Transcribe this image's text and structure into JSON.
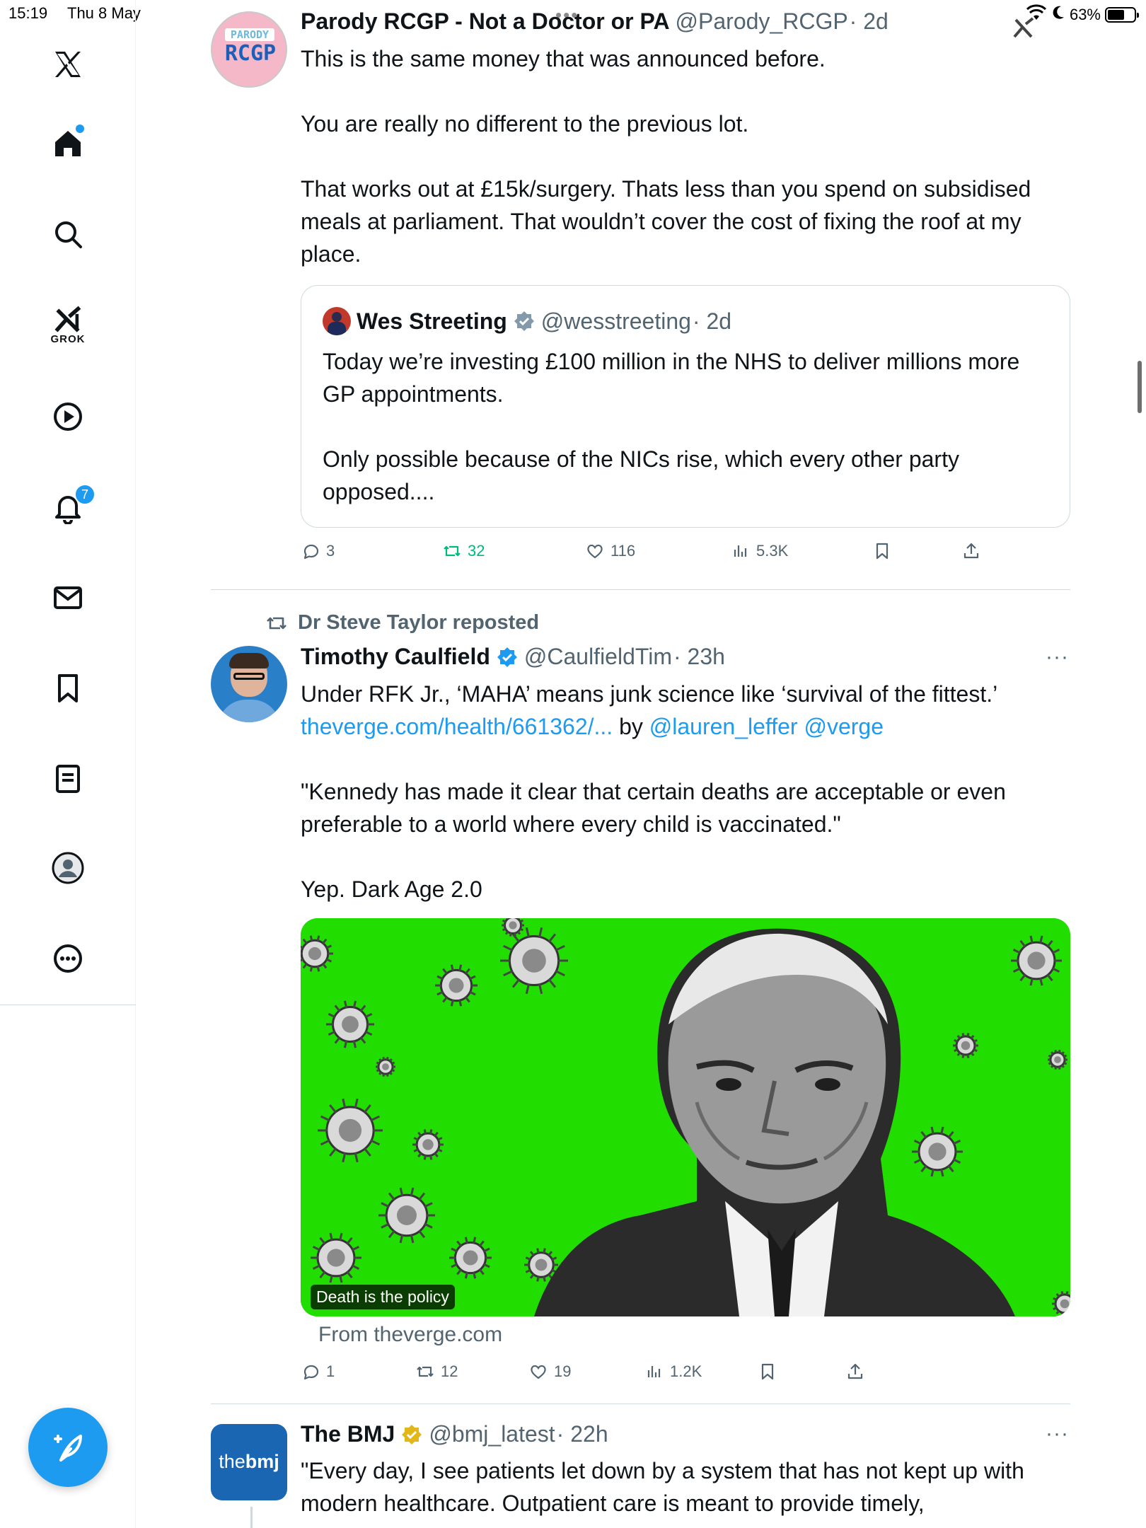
{
  "status_bar": {
    "time": "15:19",
    "date": "Thu 8 May",
    "battery": "63%",
    "battery_level": 0.63
  },
  "sidebar": {
    "notifications_badge": "7",
    "grok_label": "GROK"
  },
  "tweets": [
    {
      "name": "Parody RCGP - Not a Doctor or PA",
      "handle": "@Parody_RCGP",
      "time": "· 2d",
      "avatar_top": "PARODY",
      "avatar_main": "RCGP",
      "text": "This is the same money that was announced before.\n\nYou are really no different to the previous lot.\n\nThat works out at £15k/surgery. Thats less than you spend on subsidised meals at parliament. That wouldn’t cover the cost of fixing the roof at my place.",
      "quote": {
        "name": "Wes Streeting",
        "handle": "@wesstreeting",
        "time": "· 2d",
        "text": "Today we’re investing £100 million in the NHS to deliver millions more GP appointments.\n\nOnly possible because of the NICs rise, which every other party opposed...."
      },
      "replies": "3",
      "reposts": "32",
      "likes": "116",
      "views": "5.3K"
    },
    {
      "reposted_by": "Dr Steve Taylor reposted",
      "name": "Timothy Caulfield",
      "handle": "@CaulfieldTim",
      "time": "· 23h",
      "text_line1": "Under RFK Jr., ‘MAHA’ means junk science like ‘survival of the fittest.’",
      "link_url": "theverge.com/health/661362/...",
      "link_by": " by ",
      "mention1": "@lauren_leffer",
      "mention2": " @verge",
      "text_rest": "\"Kennedy has made it clear that certain deaths are acceptable or even preferable to a world where every child is vaccinated.\"\n\nYep. Dark Age 2.0",
      "media_caption": "Death is the policy",
      "from": "From theverge.com",
      "replies": "1",
      "reposts": "12",
      "likes": "19",
      "views": "1.2K"
    },
    {
      "name": "The BMJ",
      "handle": "@bmj_latest",
      "time": "· 22h",
      "avatar_the": "the",
      "avatar_bmj": "bmj",
      "text": "\"Every day, I see patients let down by a system that has not kept up with modern healthcare. Outpatient care is meant to provide timely,"
    }
  ],
  "colors": {
    "accent": "#1d9bf0",
    "repost_green": "#00ba7c",
    "media_green": "#22dd00",
    "bmj_blue": "#1a66b3",
    "gold_check": "#e2b719"
  }
}
